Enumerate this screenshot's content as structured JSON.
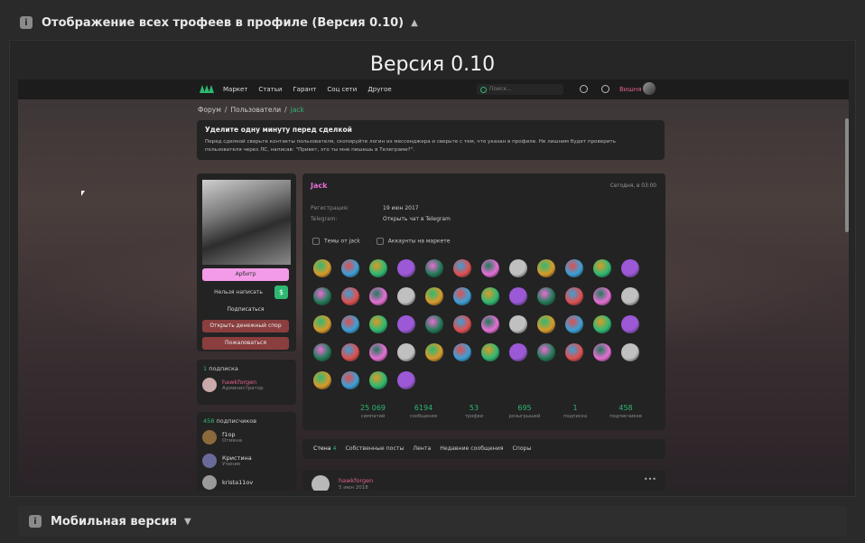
{
  "spoiler_top": {
    "title": "Отображение всех трофеев в профиле (Версия 0.10)"
  },
  "version_title": "Версия 0.10",
  "nav": {
    "items": [
      "Маркет",
      "Статьи",
      "Гарант",
      "Соц сети",
      "Другое"
    ],
    "search_placeholder": "Поиск...",
    "username": "Вишня"
  },
  "breadcrumb": [
    "Форум",
    "Пользователи",
    "jack"
  ],
  "notice": {
    "title": "Уделите одну минуту перед сделкой",
    "text": "Перед сделкой сверьте контакты пользователя, скопируйте логин из мессенджера и сверьте с тем, что указан в профиле. Не лишним будет проверить пользователя через ЛС, написав: \"Привет, это ты мне пишешь в Телеграме?\"."
  },
  "profile_actions": {
    "arbiter": "Арбитр",
    "cannot_write": "Нельзя написать",
    "dollar": "$",
    "subscribe": "Подписаться",
    "open_dispute": "Открыть денежный спор",
    "report": "Пожаловаться"
  },
  "subscriptions": {
    "count": "1",
    "label": "подписка",
    "people": [
      {
        "name": "hawkforgen",
        "role": "Администратор"
      }
    ]
  },
  "followers": {
    "count": "458",
    "label": "подписчиков",
    "people": [
      {
        "name": "f1op",
        "role": "Отмена"
      },
      {
        "name": "Кристина",
        "role": "Ученик"
      },
      {
        "name": "krista11ov",
        "role": ""
      }
    ]
  },
  "profile": {
    "name": "Jack",
    "last_seen": "Сегодня, в 03:00",
    "registration_label": "Регистрация:",
    "registration_value": "19 июн 2017",
    "telegram_label": "Telegram:",
    "telegram_value": "Открыть чат в Telegram",
    "check_topics": "Темы от jack",
    "check_accounts": "Аккаунты на маркете",
    "trophy_count": 52
  },
  "stats": [
    {
      "value": "25 069",
      "label": "симпатий"
    },
    {
      "value": "6194",
      "label": "сообщения"
    },
    {
      "value": "53",
      "label": "трофеи"
    },
    {
      "value": "695",
      "label": "розыгрышей"
    },
    {
      "value": "1",
      "label": "подписка"
    },
    {
      "value": "458",
      "label": "подписчиков"
    }
  ],
  "tabs": [
    "Стена",
    "Собственные посты",
    "Лента",
    "Недавние сообщения",
    "Споры"
  ],
  "wall_count": "4",
  "post": {
    "author": "hawkforgen",
    "date": "5 июн 2018",
    "menu": "•••"
  },
  "spoiler_bottom": {
    "title": "Мобильная версия"
  },
  "colors": {
    "accent": "#2eb872",
    "pink": "#e86fd6",
    "danger": "#8a3e3e"
  }
}
